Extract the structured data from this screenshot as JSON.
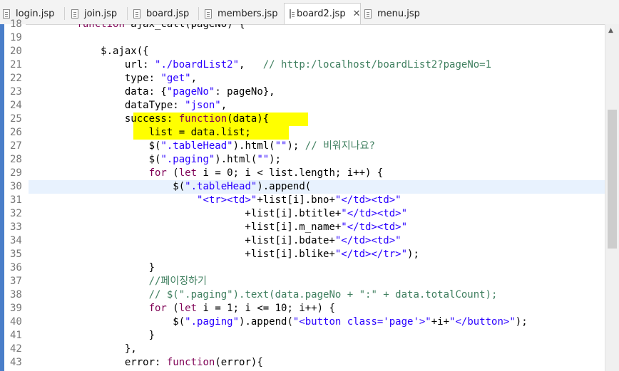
{
  "tabs": [
    {
      "label": "login.jsp",
      "active": false
    },
    {
      "label": "join.jsp",
      "active": false
    },
    {
      "label": "board.jsp",
      "active": false
    },
    {
      "label": "members.jsp",
      "active": false
    },
    {
      "label": "board2.jsp",
      "active": true
    },
    {
      "label": "menu.jsp",
      "active": false
    }
  ],
  "close_glyph": "✕",
  "editor": {
    "current_line": 30,
    "lines": [
      {
        "n": "18",
        "code": "        function ajax_call(pageNo) {"
      },
      {
        "n": "19",
        "code": ""
      },
      {
        "n": "20",
        "code": "            $.ajax({"
      },
      {
        "n": "21",
        "code": "                url: \"./boardList2\",   // http:/localhost/boardList2?pageNo=1"
      },
      {
        "n": "22",
        "code": "                type: \"get\","
      },
      {
        "n": "23",
        "code": "                data: {\"pageNo\": pageNo},"
      },
      {
        "n": "24",
        "code": "                dataType: \"json\","
      },
      {
        "n": "25",
        "code": "                success: function(data){"
      },
      {
        "n": "26",
        "code": "                    list = data.list;"
      },
      {
        "n": "27",
        "code": "                    $(\".tableHead\").html(\"\"); // 비워지나요?"
      },
      {
        "n": "28",
        "code": "                    $(\".paging\").html(\"\");"
      },
      {
        "n": "29",
        "code": "                    for (let i = 0; i < list.length; i++) {"
      },
      {
        "n": "30",
        "code": "                        $(\".tableHead\").append("
      },
      {
        "n": "31",
        "code": "                            \"<tr><td>\"+list[i].bno+\"</td><td>\""
      },
      {
        "n": "32",
        "code": "                                    +list[i].btitle+\"</td><td>\""
      },
      {
        "n": "33",
        "code": "                                    +list[i].m_name+\"</td><td>\""
      },
      {
        "n": "34",
        "code": "                                    +list[i].bdate+\"</td><td>\""
      },
      {
        "n": "35",
        "code": "                                    +list[i].blike+\"</td></tr>\");"
      },
      {
        "n": "36",
        "code": "                    }"
      },
      {
        "n": "37",
        "code": "                    //페이징하기"
      },
      {
        "n": "38",
        "code": "                    // $(\".paging\").text(data.pageNo + \":\" + data.totalCount);"
      },
      {
        "n": "39",
        "code": "                    for (let i = 1; i <= 10; i++) {"
      },
      {
        "n": "40",
        "code": "                        $(\".paging\").append(\"<button class='page'>\"+i+\"</button>\");"
      },
      {
        "n": "41",
        "code": "                    }"
      },
      {
        "n": "42",
        "code": "                },"
      },
      {
        "n": "43",
        "code": "                error: function(error){"
      }
    ]
  },
  "scrollbar": {
    "up_arrow": "▲"
  },
  "colors": {
    "keyword": "#7f0055",
    "string": "#2a00ff",
    "comment": "#3f7f5f",
    "highlight": "#ffff00",
    "current_line": "#e8f2fe"
  }
}
